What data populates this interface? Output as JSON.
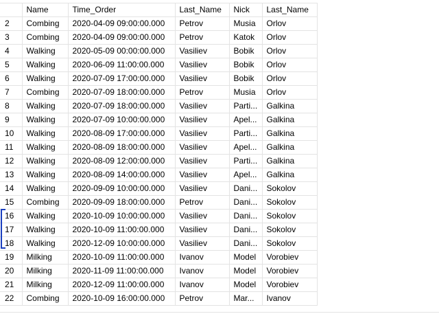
{
  "headers": [
    "",
    "Name",
    "Time_Order",
    "Last_Name",
    "Nick",
    "Last_Name"
  ],
  "rows": [
    [
      "2",
      "Combing",
      "2020-04-09 09:00:00.000",
      "Petrov",
      "Musia",
      "Orlov"
    ],
    [
      "3",
      "Combing",
      "2020-04-09 09:00:00.000",
      "Petrov",
      "Katok",
      "Orlov"
    ],
    [
      "4",
      "Walking",
      "2020-05-09 00:00:00.000",
      "Vasiliev",
      "Bobik",
      "Orlov"
    ],
    [
      "5",
      "Walking",
      "2020-06-09 11:00:00.000",
      "Vasiliev",
      "Bobik",
      "Orlov"
    ],
    [
      "6",
      "Walking",
      "2020-07-09 17:00:00.000",
      "Vasiliev",
      "Bobik",
      "Orlov"
    ],
    [
      "7",
      "Combing",
      "2020-07-09 18:00:00.000",
      "Petrov",
      "Musia",
      "Orlov"
    ],
    [
      "8",
      "Walking",
      "2020-07-09 18:00:00.000",
      "Vasiliev",
      "Parti...",
      "Galkina"
    ],
    [
      "9",
      "Walking",
      "2020-07-09 10:00:00.000",
      "Vasiliev",
      "Apel...",
      "Galkina"
    ],
    [
      "10",
      "Walking",
      "2020-08-09 17:00:00.000",
      "Vasiliev",
      "Parti...",
      "Galkina"
    ],
    [
      "11",
      "Walking",
      "2020-08-09 18:00:00.000",
      "Vasiliev",
      "Apel...",
      "Galkina"
    ],
    [
      "12",
      "Walking",
      "2020-08-09 12:00:00.000",
      "Vasiliev",
      "Parti...",
      "Galkina"
    ],
    [
      "13",
      "Walking",
      "2020-08-09 14:00:00.000",
      "Vasiliev",
      "Apel...",
      "Galkina"
    ],
    [
      "14",
      "Walking",
      "2020-09-09 10:00:00.000",
      "Vasiliev",
      "Dani...",
      "Sokolov"
    ],
    [
      "15",
      "Combing",
      "2020-09-09 18:00:00.000",
      "Petrov",
      "Dani...",
      "Sokolov"
    ],
    [
      "16",
      "Walking",
      "2020-10-09 10:00:00.000",
      "Vasiliev",
      "Dani...",
      "Sokolov"
    ],
    [
      "17",
      "Walking",
      "2020-10-09 11:00:00.000",
      "Vasiliev",
      "Dani...",
      "Sokolov"
    ],
    [
      "18",
      "Walking",
      "2020-12-09 10:00:00.000",
      "Vasiliev",
      "Dani...",
      "Sokolov"
    ],
    [
      "19",
      "Milking",
      "2020-10-09 11:00:00.000",
      "Ivanov",
      "Model",
      "Vorobiev"
    ],
    [
      "20",
      "Milking",
      "2020-11-09 11:00:00.000",
      "Ivanov",
      "Model",
      "Vorobiev"
    ],
    [
      "21",
      "Milking",
      "2020-12-09 11:00:00.000",
      "Ivanov",
      "Model",
      "Vorobiev"
    ],
    [
      "22",
      "Combing",
      "2020-10-09 16:00:00.000",
      "Petrov",
      "Mar...",
      "Ivanov"
    ]
  ],
  "colors": {
    "grid_line": "#e3e3e3",
    "bracket_annotation": "#1a3fbf"
  }
}
